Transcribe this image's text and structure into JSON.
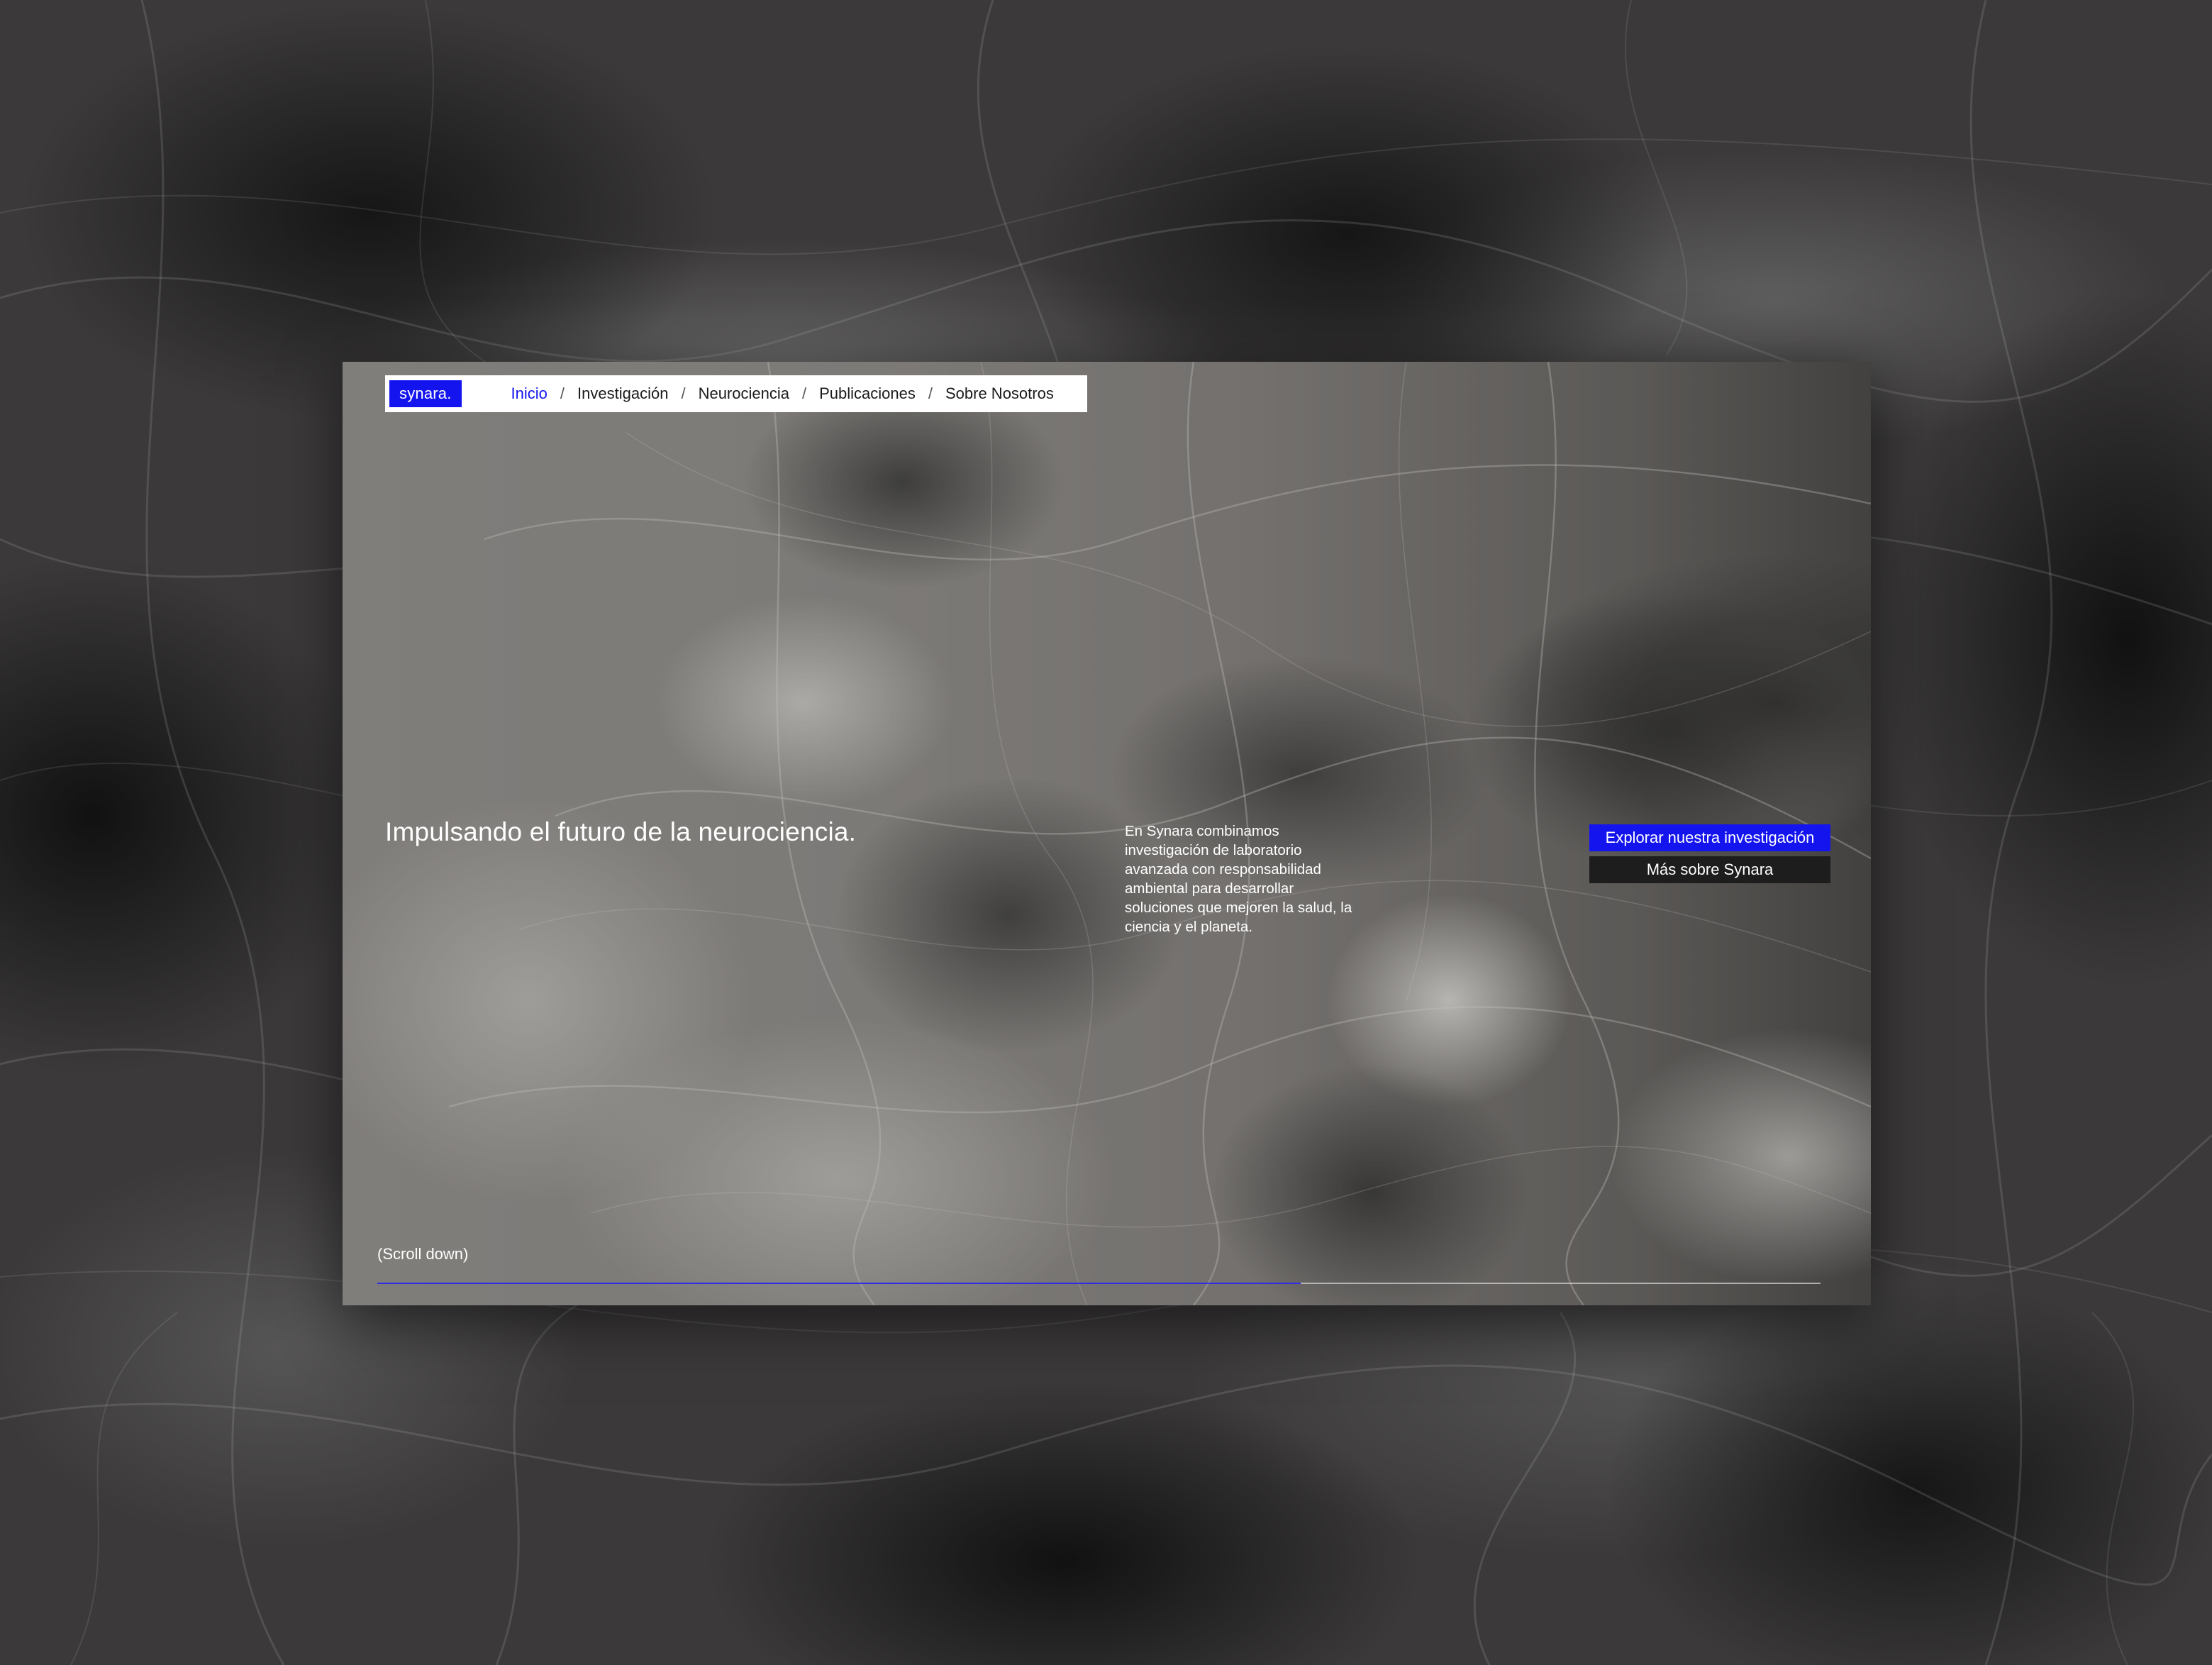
{
  "brand": {
    "logo": "synara.",
    "accent_color": "#1414ee",
    "dark_color": "#1e1d1d"
  },
  "nav": {
    "items": [
      {
        "label": "Inicio",
        "active": true
      },
      {
        "label": "Investigación",
        "active": false
      },
      {
        "label": "Neurociencia",
        "active": false
      },
      {
        "label": "Publicaciones",
        "active": false
      },
      {
        "label": "Sobre Nosotros",
        "active": false
      }
    ],
    "separator": "/"
  },
  "hero": {
    "title": "Impulsando el futuro de la neurociencia.",
    "description": "En Synara combinamos investigación de laboratorio avanzada con responsabilidad ambiental para desarrollar soluciones que mejoren la salud, la ciencia y el planeta.",
    "primary_cta": "Explorar nuestra investigación",
    "secondary_cta": "Más sobre Synara"
  },
  "scroll": {
    "label": "(Scroll down)",
    "progress": 0.64
  }
}
